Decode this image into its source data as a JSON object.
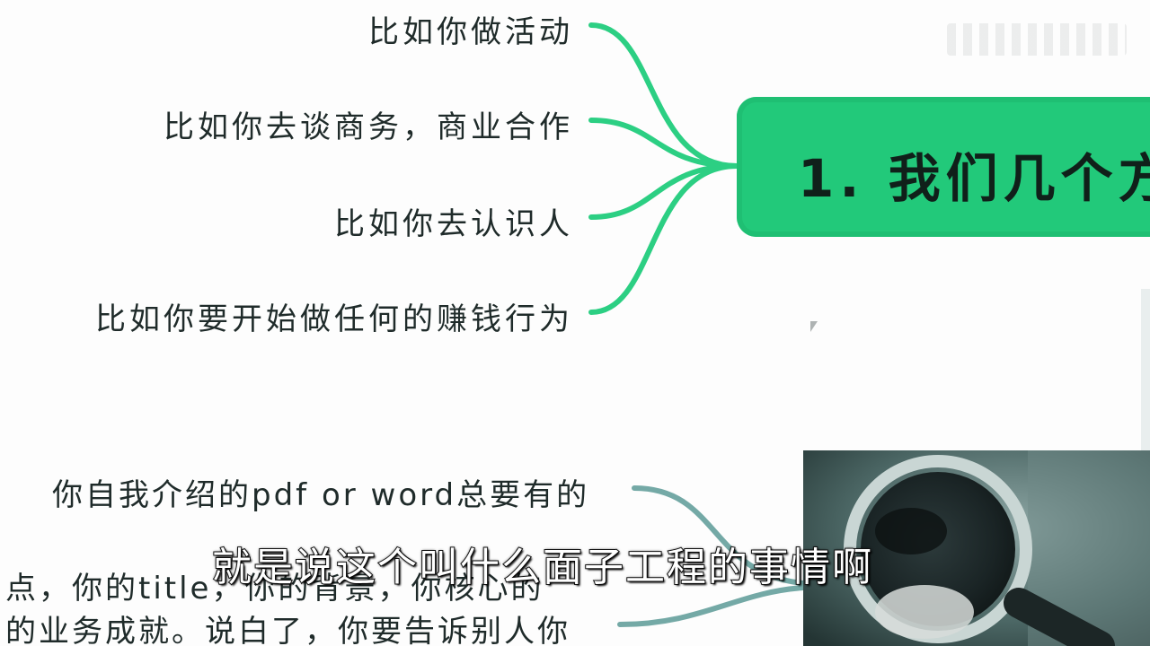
{
  "mindmap": {
    "topic_title": "1. 我们几个方",
    "branches": [
      "比如你做活动",
      "比如你去谈商务，商业合作",
      "比如你去认识人",
      "比如你要开始做任何的赚钱行为"
    ],
    "lower_lines": [
      "你自我介绍的pdf or word总要有的",
      "点，你的title，你的背景，你核心的",
      "的业务成就。说白了，你要告诉别人你"
    ]
  },
  "subtitle": "就是说这个叫什么面子工程的事情啊",
  "colors": {
    "accent_green": "#22c97a",
    "teal_connector": "#74a9a6",
    "text_dark": "#1f2b2a"
  }
}
